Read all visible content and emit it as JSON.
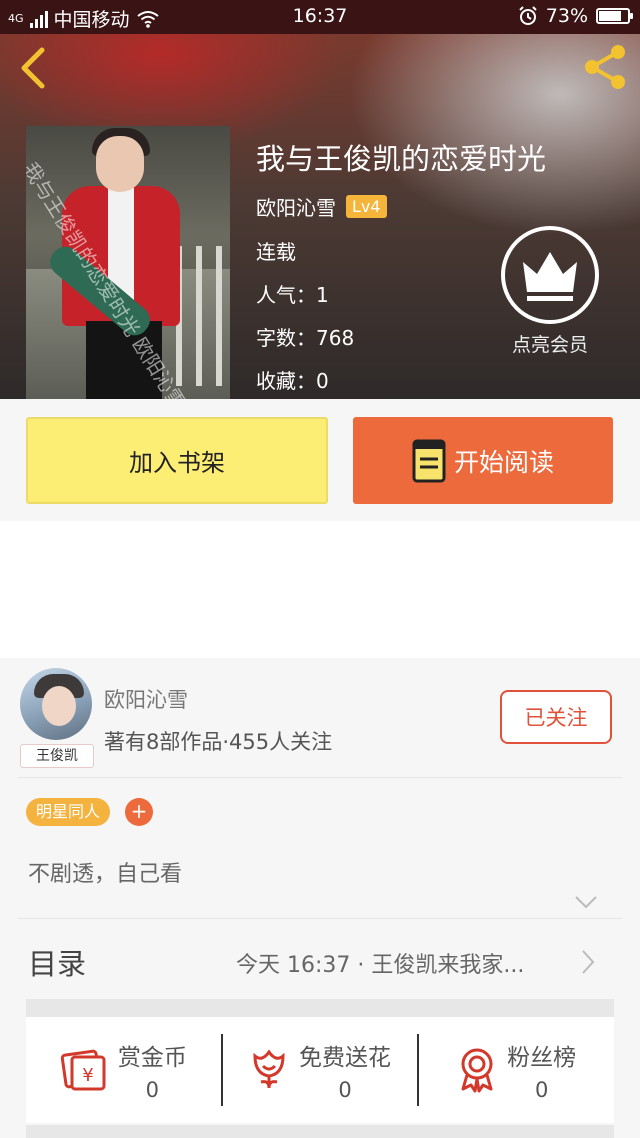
{
  "status_bar": {
    "network": "4G",
    "carrier": "中国移动",
    "time": "16:37",
    "battery": "73%",
    "battery_level": 0.73
  },
  "book": {
    "title": "我与王俊凯的恋爱时光",
    "author": "欧阳沁雪",
    "level": "Lv4",
    "status": "连载",
    "popularity": "人气：1",
    "word_count": "字数：768",
    "favorites": "收藏：0",
    "cover_watermark": "我与王俊凯的恋爱时光 欧阳沁雪"
  },
  "vip": {
    "label": "点亮会员"
  },
  "actions": {
    "add_to_shelf": "加入书架",
    "start_reading": "开始阅读"
  },
  "author_card": {
    "name": "欧阳沁雪",
    "stats": "著有8部作品·455人关注",
    "avatar_tag": "王俊凯",
    "follow_label": "已关注"
  },
  "tags": {
    "items": [
      "明星同人"
    ],
    "add": "+"
  },
  "summary": "不剧透，自己看",
  "toc": {
    "label": "目录",
    "latest": "今天 16:37 · 王俊凯来我家..."
  },
  "rewards": [
    {
      "label": "赏金币",
      "value": "0",
      "icon": "gold-coin-envelope-icon"
    },
    {
      "label": "免费送花",
      "value": "0",
      "icon": "flower-icon"
    },
    {
      "label": "粉丝榜",
      "value": "0",
      "icon": "ribbon-medal-icon"
    }
  ],
  "colors": {
    "primary_orange": "#ec6a3b",
    "shelf_yellow": "#fcee75",
    "tag_yellow": "#f4b33f",
    "follow_red": "#e0533a",
    "icon_red": "#d3392b"
  }
}
